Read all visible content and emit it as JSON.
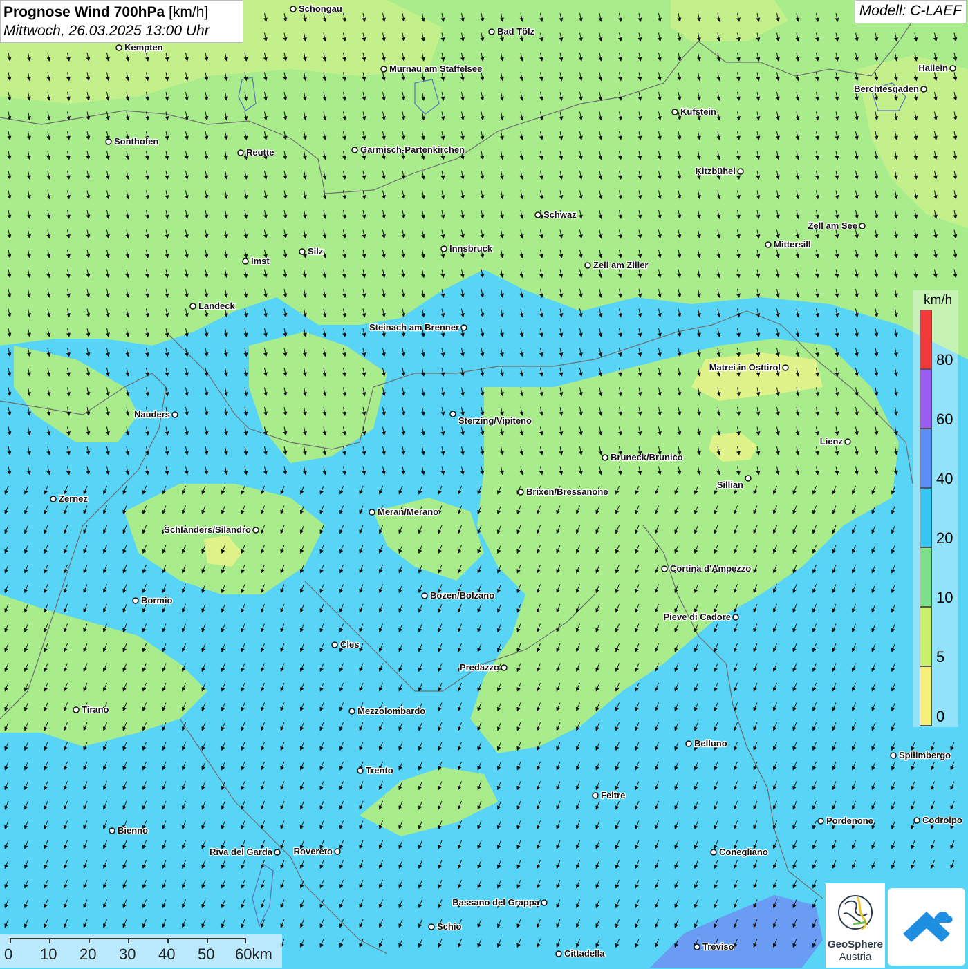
{
  "header": {
    "title_bold": "Prognose Wind 700hPa",
    "title_unit": " [km/h]",
    "subtitle": "Mittwoch, 26.03.2025 13:00 Uhr",
    "model": "Modell: C-LAEF"
  },
  "legend": {
    "unit": "km/h",
    "bands": [
      {
        "label": "80",
        "color": "#f23a3a"
      },
      {
        "label": "60",
        "color": "#9b5cf0"
      },
      {
        "label": "40",
        "color": "#5b8ff5"
      },
      {
        "label": "20",
        "color": "#36c6f0"
      },
      {
        "label": "10",
        "color": "#7fe08a"
      },
      {
        "label": "5",
        "color": "#c8f06a"
      },
      {
        "label": "0",
        "color": "#f5f07a"
      }
    ]
  },
  "scalebar": {
    "labels": [
      "0",
      "10",
      "20",
      "30",
      "40",
      "50",
      "60km"
    ]
  },
  "logos": {
    "brand_line1": "GeoSphere",
    "brand_line2": "Austria"
  },
  "colors": {
    "calm_green": "#a8ec8c",
    "light_green": "#c4f08c",
    "yellowish": "#e0f28a",
    "blue_20": "#58d4f6",
    "blue_deep": "#6a9cf4",
    "border_grey": "#6e6e6e"
  },
  "cities": [
    {
      "name": "Schongau"
    },
    {
      "name": "Bad Tölz"
    },
    {
      "name": "Kempten"
    },
    {
      "name": "Murnau am Staffelsee"
    },
    {
      "name": "Hallein"
    },
    {
      "name": "Berchtesgaden"
    },
    {
      "name": "Kufstein"
    },
    {
      "name": "Sonthofen"
    },
    {
      "name": "Reutte"
    },
    {
      "name": "Garmisch-Partenkirchen"
    },
    {
      "name": "Kitzbühel"
    },
    {
      "name": "Schwaz"
    },
    {
      "name": "Zell am See"
    },
    {
      "name": "Mittersill"
    },
    {
      "name": "Innsbruck"
    },
    {
      "name": "Silz"
    },
    {
      "name": "Imst"
    },
    {
      "name": "Zell am Ziller"
    },
    {
      "name": "Landeck"
    },
    {
      "name": "Steinach am Brenner"
    },
    {
      "name": "Matrei in Osttirol"
    },
    {
      "name": "Nauders"
    },
    {
      "name": "Sterzing/Vipiteno"
    },
    {
      "name": "Lienz"
    },
    {
      "name": "Bruneck/Brunico"
    },
    {
      "name": "Sillian"
    },
    {
      "name": "Brixen/Bressanone"
    },
    {
      "name": "Zernez"
    },
    {
      "name": "Meran/Merano"
    },
    {
      "name": "Schlanders/Silandro"
    },
    {
      "name": "Cortina d'Ampezzo"
    },
    {
      "name": "Bozen/Bolzano"
    },
    {
      "name": "Bormio"
    },
    {
      "name": "Pieve di Cadore"
    },
    {
      "name": "Cles"
    },
    {
      "name": "Predazzo"
    },
    {
      "name": "Tirano"
    },
    {
      "name": "Mezzolombardo"
    },
    {
      "name": "Belluno"
    },
    {
      "name": "Spilimbergo"
    },
    {
      "name": "Trento"
    },
    {
      "name": "Feltre"
    },
    {
      "name": "Pordenone"
    },
    {
      "name": "Codroipo"
    },
    {
      "name": "Bienno"
    },
    {
      "name": "Riva del Garda"
    },
    {
      "name": "Rovereto"
    },
    {
      "name": "Conegliano"
    },
    {
      "name": "Bassano del Grappa"
    },
    {
      "name": "Schio"
    },
    {
      "name": "Treviso"
    },
    {
      "name": "Cittadella"
    }
  ],
  "wind_direction": "from north-northeast"
}
